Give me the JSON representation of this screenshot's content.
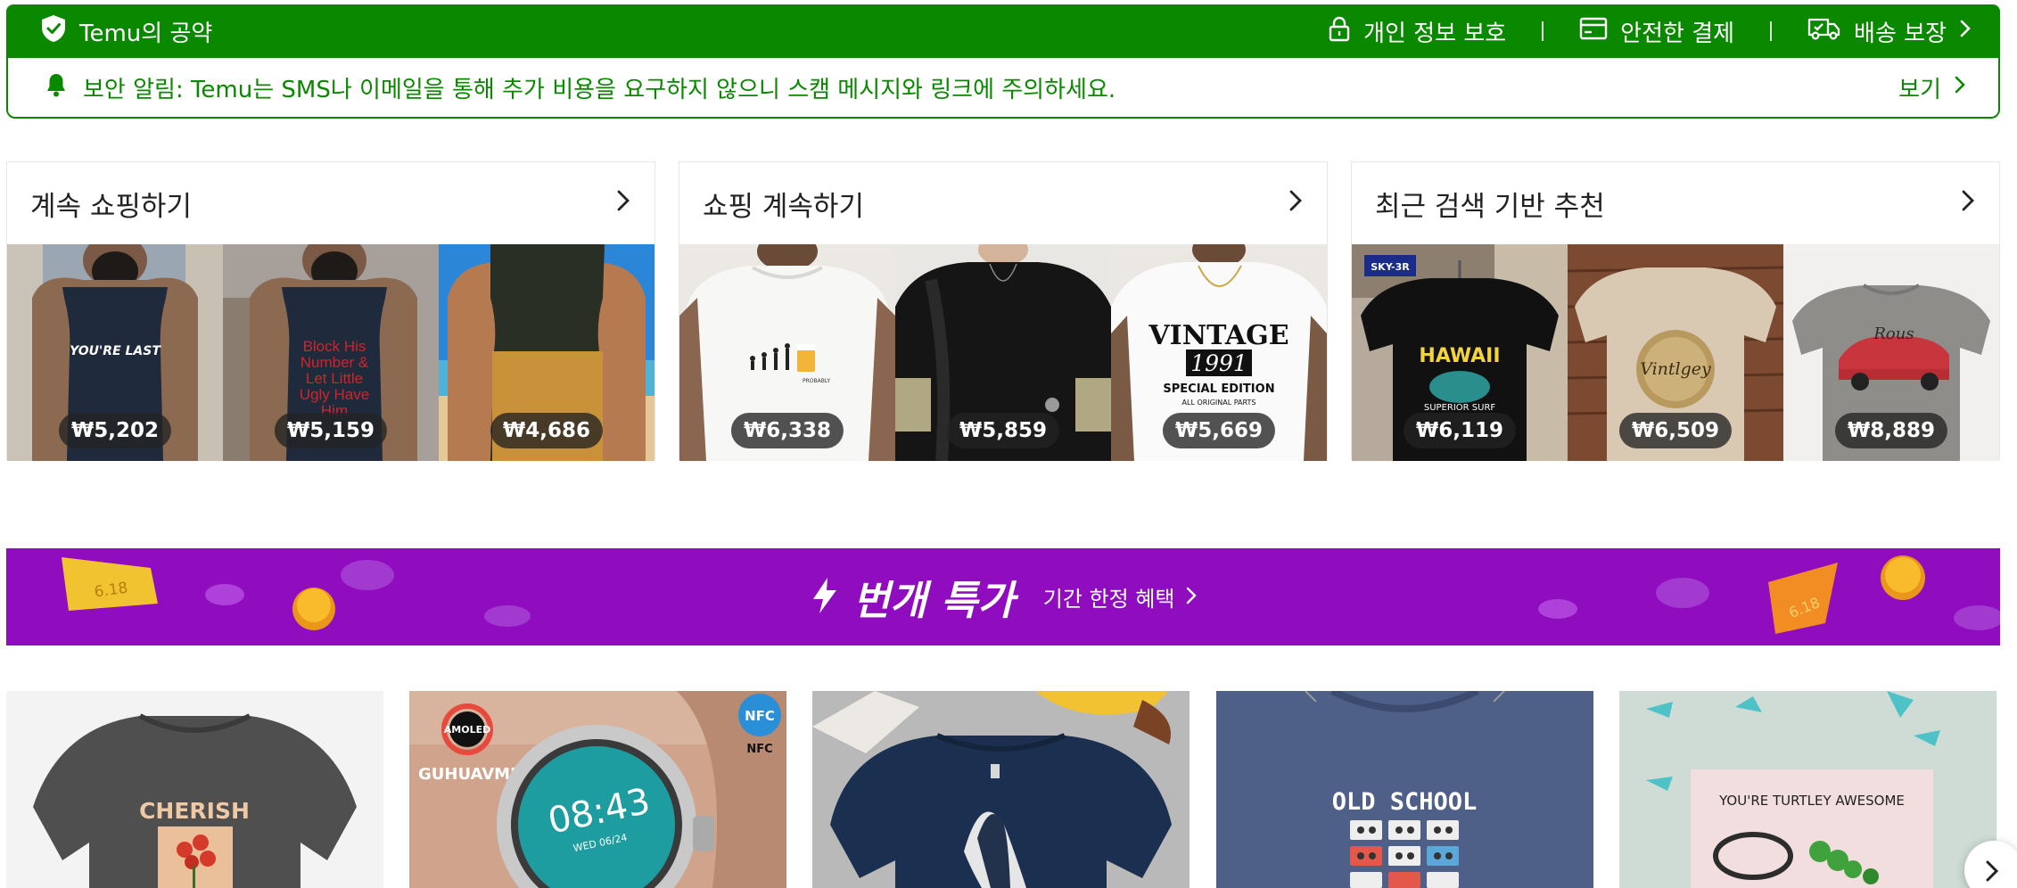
{
  "promise": {
    "title": "Temu의 공약",
    "items": [
      {
        "icon": "lock-icon",
        "label": "개인 정보 보호"
      },
      {
        "icon": "card-icon",
        "label": "안전한 결제"
      },
      {
        "icon": "truck-icon",
        "label": "배송 보장"
      }
    ]
  },
  "notice": {
    "text": "보안 알림: Temu는 SMS나 이메일을 통해 추가 비용을 요구하지 않으니 스캠 메시지와 링크에 주의하세요.",
    "view_label": "보기"
  },
  "cards": [
    {
      "title": "계속 쇼핑하기",
      "items": [
        {
          "price": "₩5,202"
        },
        {
          "price": "₩5,159"
        },
        {
          "price": "₩4,686"
        }
      ]
    },
    {
      "title": "쇼핑 계속하기",
      "items": [
        {
          "price": "₩6,338"
        },
        {
          "price": "₩5,859"
        },
        {
          "price": "₩5,669"
        }
      ]
    },
    {
      "title": "최근 검색 기반 추천",
      "items": [
        {
          "price": "₩6,119"
        },
        {
          "price": "₩6,509"
        },
        {
          "price": "₩8,889"
        }
      ]
    }
  ],
  "product_texts": {
    "card1_shirt1": "YOU'RE LAST",
    "card1_shirt2": "Block His Number & Let Little Ugly Have Him",
    "card2_shirt3_line1": "VINTAGE",
    "card2_shirt3_line2": "1991",
    "card2_shirt3_line3": "SPECIAL EDITION",
    "card2_shirt3_line4": "ALL ORIGINAL PARTS",
    "card3_shirt1": "HAWAII",
    "card3_shirt1_sub": "SUPERIOR SURF",
    "card3_shirt1_tag": "SKY-3R",
    "card3_shirt2": "Vintlgey"
  },
  "deals": {
    "title": "번개 특가",
    "subtitle": "기간 한정 혜택",
    "sticker": "6.18"
  },
  "products": [
    {
      "name": "cherish-tshirt",
      "text": "CHERISH"
    },
    {
      "name": "guhuavmi-smartwatch",
      "brand": "GUHUAVMI",
      "badge": "AMOLED",
      "nfc": "NFC",
      "time": "08:43",
      "date": "WED 06/24"
    },
    {
      "name": "whale-tshirt"
    },
    {
      "name": "old-school-tshirt",
      "text": "OLD SCHOOL"
    },
    {
      "name": "turtle-card",
      "text": "YOU'RE TURTLEY AWESOME"
    }
  ],
  "colors": {
    "green": "#0a8800",
    "purple": "#8f0cbf",
    "price_pill": "#232323"
  }
}
